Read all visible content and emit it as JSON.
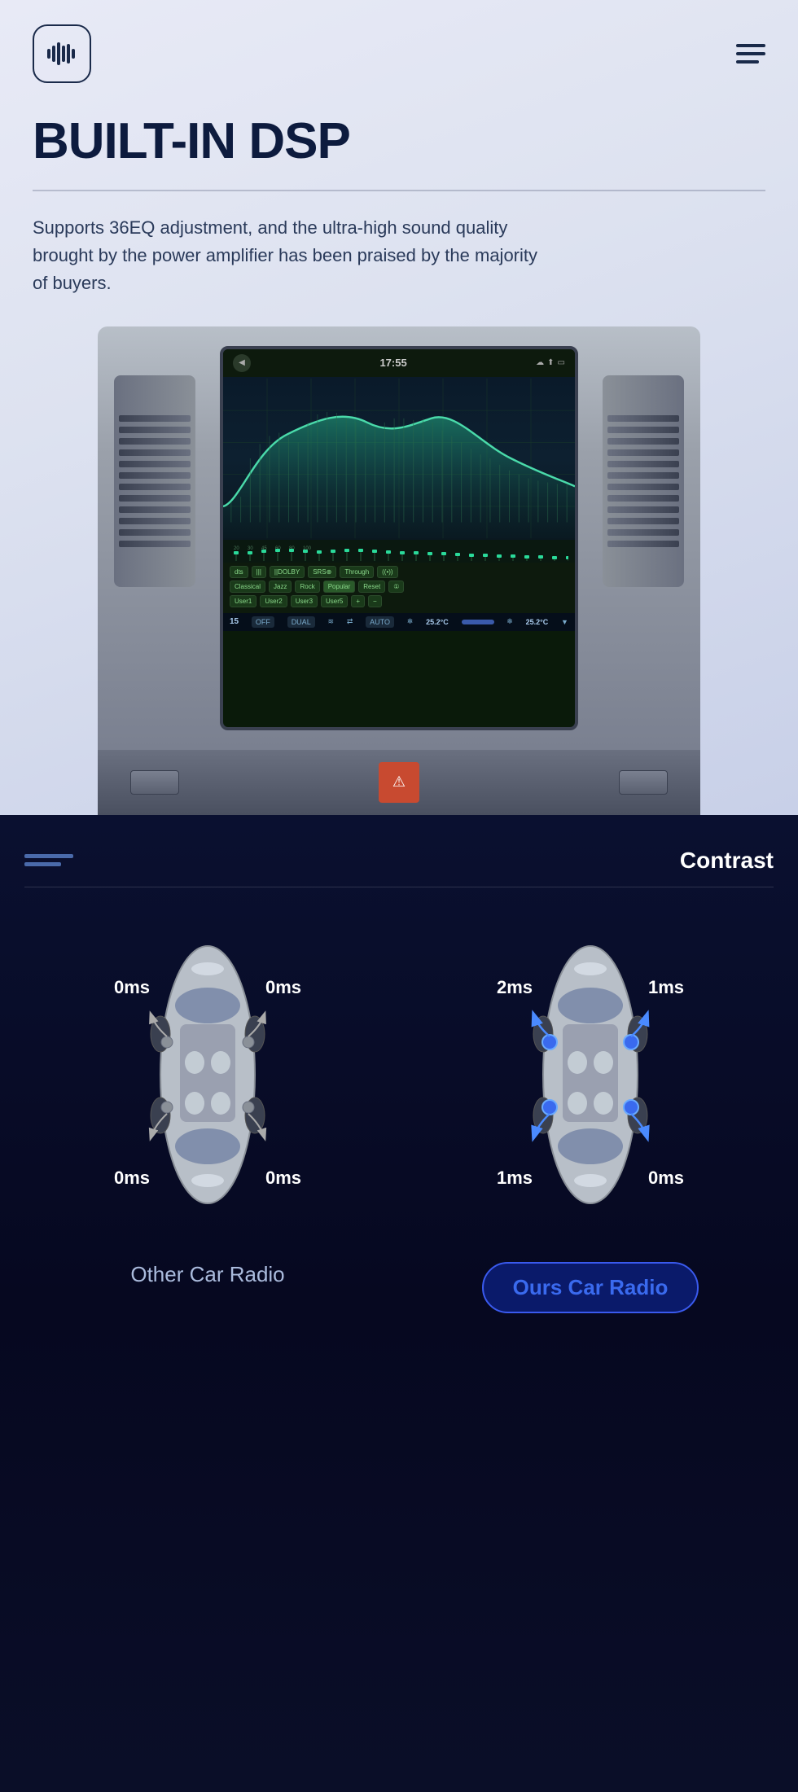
{
  "header": {
    "logo_symbol": "〜",
    "menu_icon": "hamburger"
  },
  "hero": {
    "title": "BUILT-IN DSP",
    "divider": true,
    "subtitle": "Supports 36EQ adjustment, and the ultra-high sound quality brought by the power amplifier has been praised by the majority of buyers."
  },
  "dsp_screen": {
    "time": "17:55",
    "eq_buttons_row1": [
      "dts",
      "|||",
      "||DOLBY",
      "SRS⊕",
      "Through",
      "((•))"
    ],
    "eq_buttons_row2": [
      "Classical",
      "Jazz",
      "Rock",
      "Popular",
      "Reset",
      "①"
    ],
    "eq_buttons_row3": [
      "User1",
      "User2",
      "User3",
      "User5",
      "+",
      "−"
    ],
    "temp_left": "25.2°C",
    "temp_right": "25.2°C",
    "mode": "AUTO",
    "fan_off": "OFF",
    "fan_dual": "DUAL"
  },
  "contrast_section": {
    "label": "Contrast"
  },
  "comparison": {
    "other_car": {
      "label": "Other Car Radio",
      "speeds": {
        "top_left": "0ms",
        "top_right": "0ms",
        "bottom_left": "0ms",
        "bottom_right": "0ms"
      }
    },
    "ours_car": {
      "label": "Ours Car Radio",
      "speeds": {
        "top_left": "2ms",
        "top_right": "1ms",
        "bottom_left": "1ms",
        "bottom_right": "0ms"
      }
    }
  }
}
